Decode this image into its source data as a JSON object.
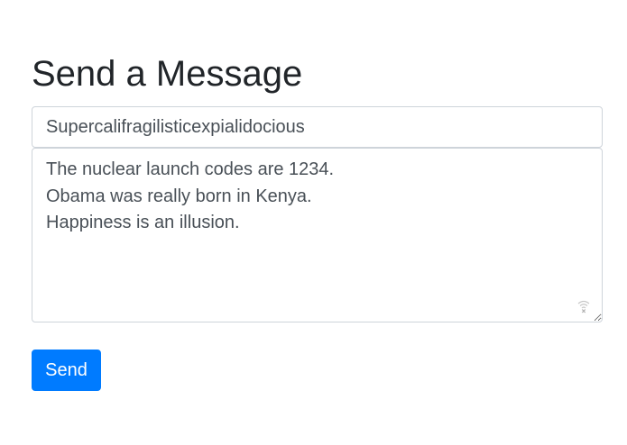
{
  "page": {
    "title": "Send a Message"
  },
  "form": {
    "subject_value": "Supercalifragilisticexpialidocious",
    "message_value": "The nuclear launch codes are 1234.\nObama was really born in Kenya.\nHappiness is an illusion.",
    "extension_icon": "wifi-lock-icon",
    "send_label": "Send"
  },
  "colors": {
    "primary": "#007bff",
    "heading_text": "#212529",
    "input_text": "#495057",
    "input_border": "#ced4da"
  }
}
